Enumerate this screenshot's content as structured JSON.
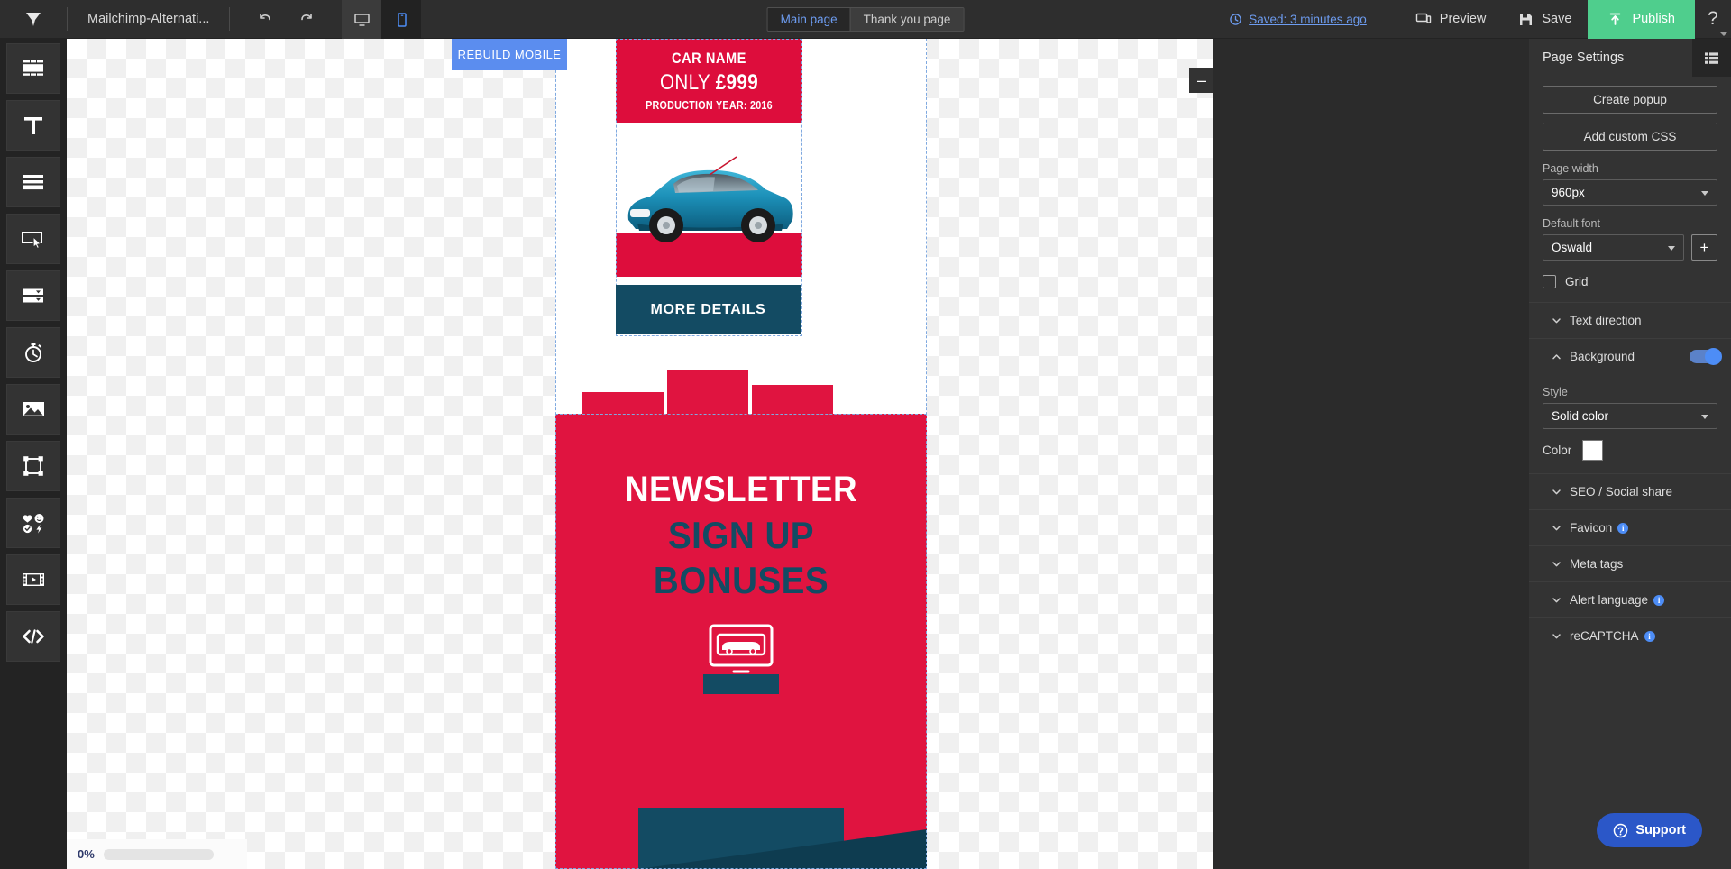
{
  "topbar": {
    "logo_icon": "brand-logo-icon",
    "document_title": "Mailchimp-Alternati...",
    "undo_icon": "undo-icon",
    "redo_icon": "redo-icon",
    "desktop_icon": "desktop-view-icon",
    "mobile_icon": "mobile-view-icon",
    "tabs": [
      {
        "label": "Main page",
        "active": true
      },
      {
        "label": "Thank you page",
        "active": false
      }
    ],
    "saved_status": "Saved: 3 minutes ago",
    "saved_icon": "history-clock-icon",
    "preview_label": "Preview",
    "preview_icon": "preview-monitor-icon",
    "save_label": "Save",
    "save_icon": "floppy-disk-icon",
    "publish_label": "Publish",
    "publish_icon": "publish-upload-icon",
    "publish_color": "#4fce8d",
    "help_label": "?"
  },
  "left_rail": {
    "items": [
      {
        "icon": "blocks-sections-icon",
        "name": "blocks"
      },
      {
        "icon": "text-t-icon",
        "name": "text"
      },
      {
        "icon": "form-rows-icon",
        "name": "form"
      },
      {
        "icon": "button-cursor-icon",
        "name": "button"
      },
      {
        "icon": "dropdown-lists-icon",
        "name": "dropdown"
      },
      {
        "icon": "timer-stopwatch-icon",
        "name": "timer"
      },
      {
        "icon": "image-picture-icon",
        "name": "image"
      },
      {
        "icon": "shape-frame-icon",
        "name": "shape"
      },
      {
        "icon": "social-widgets-icon",
        "name": "widgets"
      },
      {
        "icon": "video-film-icon",
        "name": "video"
      },
      {
        "icon": "code-embed-icon",
        "name": "code"
      }
    ]
  },
  "canvas": {
    "rebuild_mobile_label": "REBUILD MOBILE",
    "rebuild_mobile_color": "#5b8def",
    "collapse_label": "–",
    "zoom_percent": "0%",
    "hero": {
      "line1": "CAR NAME",
      "line2_prefix": "ONLY ",
      "line2_price": "£999",
      "line3": "PRODUCTION YEAR: 2016",
      "bg_color": "#dd0d3c"
    },
    "more_details_label": "MORE DETAILS",
    "more_details_color": "#134b63",
    "newsletter": {
      "line1": "NEWSLETTER",
      "line2": "SIGN UP",
      "line3": "BONUSES",
      "bg_color": "#e01440",
      "accent_color": "#134b63",
      "art_icon": "computer-car-illustration-icon"
    }
  },
  "right_panel": {
    "title": "Page Settings",
    "list_icon": "layers-list-icon",
    "create_popup_label": "Create popup",
    "add_custom_css_label": "Add custom CSS",
    "page_width_label": "Page width",
    "page_width_value": "960px",
    "default_font_label": "Default font",
    "default_font_value": "Oswald",
    "add_font_label": "+",
    "grid_label": "Grid",
    "grid_checked": false,
    "sections": [
      {
        "label": "Text direction",
        "expanded": false,
        "info": false
      },
      {
        "label": "Background",
        "expanded": true,
        "info": false,
        "toggle": true
      }
    ],
    "background": {
      "style_label": "Style",
      "style_value": "Solid color",
      "color_label": "Color",
      "color_value": "#ffffff"
    },
    "sections_bottom": [
      {
        "label": "SEO / Social share",
        "info": false
      },
      {
        "label": "Favicon",
        "info": true
      },
      {
        "label": "Meta tags",
        "info": false
      },
      {
        "label": "Alert language",
        "info": true
      },
      {
        "label": "reCAPTCHA",
        "info": true
      }
    ],
    "support_label": "Support",
    "support_icon": "question-circle-icon",
    "support_color": "#2b57c8"
  }
}
